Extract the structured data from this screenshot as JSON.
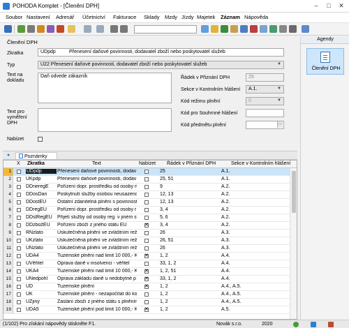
{
  "window": {
    "title": "POHODA Komplet - [Členění DPH]"
  },
  "menu": [
    "Soubor",
    "Nastavení",
    "Adresář",
    "Účetnictví",
    "Fakturace",
    "Sklady",
    "Mzdy",
    "Jízdy",
    "Majetek",
    "Záznam",
    "Nápověda"
  ],
  "form": {
    "title": "Členění DPH",
    "zkratka_label": "Zkratka",
    "zkratka_code": "UDpdp",
    "zkratka_text": "Přenesení daňové povinnosti, dodavatel zboží nebo poskytovatel služeb",
    "typ_label": "Typ",
    "typ_value": "U22 Přenesení daňové povinnosti, dodavatel zboží nebo poskytovatel služeb",
    "text_doklad_label": "Text na dokladu",
    "text_doklad_value": "Daň odvede zákazník",
    "text_vymereni_label": "Text pro vyměření DPH",
    "text_vymereni_value": "",
    "nabizet_label": "Nabízet",
    "nabizet_checked": false,
    "radek_label": "Řádek v Přiznání DPH",
    "radek_value": "25",
    "sekce_label": "Sekce v Kontrolním hlášení",
    "sekce_value": "A.1.",
    "rezim_label": "Kód režimu plnění",
    "rezim_value": "0",
    "souhrnne_label": "Kód pro Souhrnné hlášení",
    "souhrnne_value": "",
    "predmet_label": "Kód předmětu plnění",
    "predmet_value": ""
  },
  "tabs": {
    "poznamky": "Poznámky"
  },
  "grid": {
    "headers": {
      "x": "X",
      "zkratka": "Zkratka",
      "text": "Text",
      "nabizet": "Nabízet",
      "radek": "Řádek v Přiznání DPH",
      "sekce": "Sekce v Kontrolním hlášení"
    },
    "rows": [
      {
        "n": "1",
        "code": "UDpdp",
        "text": "Přenesení daňové povinnosti, dodav",
        "nab": false,
        "radek": "25",
        "sekce": "A.1."
      },
      {
        "n": "2",
        "code": "UKpdp",
        "text": "Přenesení daňové povinnosti, dodav",
        "nab": false,
        "radek": "25, 51",
        "sekce": "A.1."
      },
      {
        "n": "3",
        "code": "DDneregE",
        "text": "Pořízení dopr. prostředku od osoby n",
        "nab": false,
        "radek": "9",
        "sekce": "A.2."
      },
      {
        "n": "4",
        "code": "DDosDan",
        "text": "Poskytnutí služby osobou neusazeno",
        "nab": false,
        "radek": "12, 13",
        "sekce": "A.2."
      },
      {
        "n": "5",
        "code": "DDostEU",
        "text": "Ostatní zdanitelná plnění s povinnost",
        "nab": false,
        "radek": "12, 13",
        "sekce": "A.2."
      },
      {
        "n": "6",
        "code": "DDregEU",
        "text": "Pořízení dopr. prostředku od osoby r",
        "nab": false,
        "radek": "3, 4",
        "sekce": "A.2."
      },
      {
        "n": "7",
        "code": "DDslRegEU",
        "text": "Přijetí služby od osoby reg. v jiném st",
        "nab": false,
        "radek": "5, 6",
        "sekce": "A.2."
      },
      {
        "n": "8",
        "code": "DDzbožEU",
        "text": "Pořízení zboží z jiného státu EU",
        "nab": true,
        "radek": "3, 4",
        "sekce": "A.2."
      },
      {
        "n": "9",
        "code": "RNzlato",
        "text": "Uskutečněná plnění ve zvláštním reži",
        "nab": false,
        "radek": "26",
        "sekce": "A.3."
      },
      {
        "n": "10",
        "code": "UKzlato",
        "text": "Uskutečněná plnění ve zvláštním reži",
        "nab": false,
        "radek": "26, 51",
        "sekce": "A.3."
      },
      {
        "n": "11",
        "code": "UNzlato",
        "text": "Uskutečněná plnění ve zvláštním reži",
        "nab": false,
        "radek": "26",
        "sekce": "A.3."
      },
      {
        "n": "12",
        "code": "UDA4",
        "text": "Tuzemské plnění nad limit 10 000,- K",
        "nab": true,
        "radek": "1, 2",
        "sekce": "A.4."
      },
      {
        "n": "13",
        "code": "UVěřitel",
        "text": "Oprava daně v insolvenci - věřitel",
        "nab": false,
        "radek": "33, 1, 2",
        "sekce": "A.4."
      },
      {
        "n": "14",
        "code": "UKA4",
        "text": "Tuzemské plnění nad limit 10 000,- K",
        "nab": true,
        "radek": "1, 2, 51",
        "sekce": "A.4."
      },
      {
        "n": "15",
        "code": "UNedpohl",
        "text": "Oprava základu daně u nedobytné p",
        "nab": true,
        "radek": "33, 1, 2",
        "sekce": "A.4."
      },
      {
        "n": "16",
        "code": "UD",
        "text": "Tuzemské plnění",
        "nab": true,
        "radek": "1, 2",
        "sekce": "A.4., A.5."
      },
      {
        "n": "17",
        "code": "UK",
        "text": "Tuzemské plnění - nezapočítat do ko",
        "nab": false,
        "radek": "1, 2",
        "sekce": "A.4., A.5."
      },
      {
        "n": "18",
        "code": "UZjiný",
        "text": "Zaslání zboží z jiného státu s plněním",
        "nab": false,
        "radek": "1, 2",
        "sekce": "A.4., A.5."
      },
      {
        "n": "19",
        "code": "UDA5",
        "text": "Tuzemské plnění pod limit 10 000,- K",
        "nab": true,
        "radek": "1, 2",
        "sekce": "A.5."
      }
    ]
  },
  "agendy": {
    "header": "Agendy",
    "item": "Členění DPH"
  },
  "status": {
    "hint": "(1/102) Pro získání nápovědy stiskněte F1.",
    "company": "Novák s.r.o.",
    "year": "2020"
  }
}
